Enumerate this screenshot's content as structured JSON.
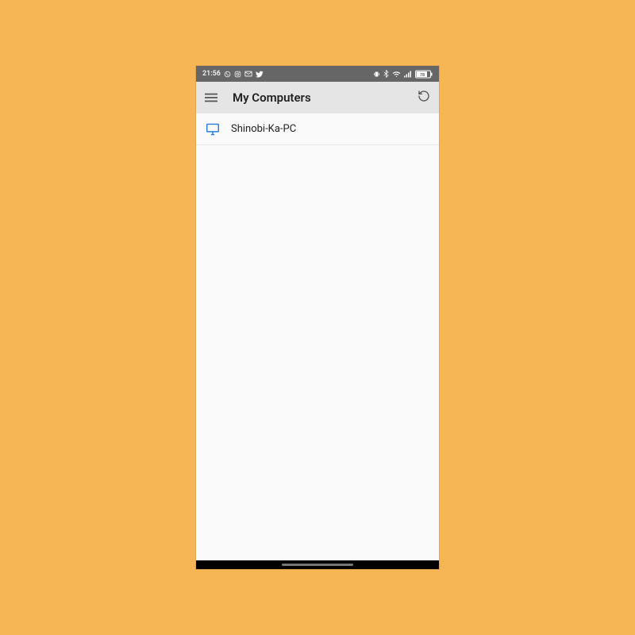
{
  "status_bar": {
    "time": "21:56",
    "battery_text": "78"
  },
  "app_bar": {
    "title": "My Computers"
  },
  "list": {
    "items": [
      {
        "label": "Shinobi-Ka-PC"
      }
    ]
  }
}
